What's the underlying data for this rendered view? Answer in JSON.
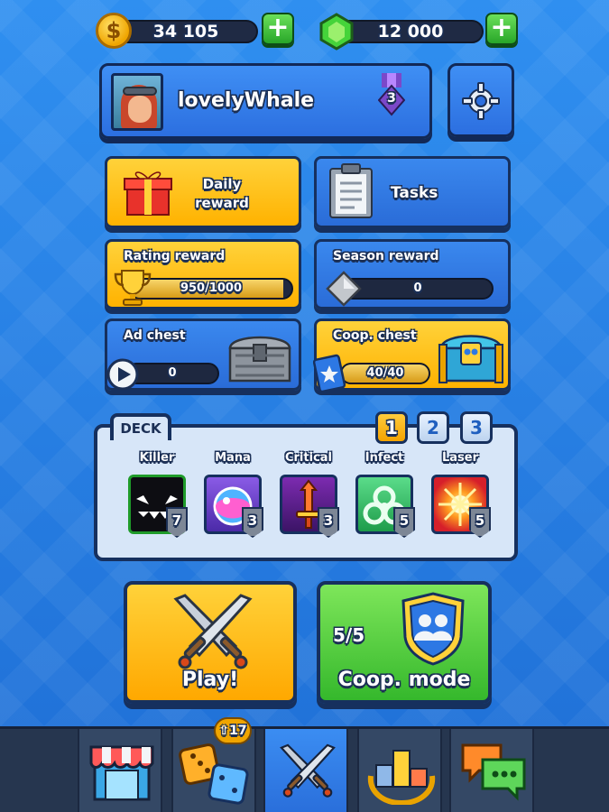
{
  "currency": {
    "coins": "34 105",
    "gems": "12 000",
    "coin_icon": "coin-icon",
    "gem_icon": "gem-icon",
    "plus_symbol": "+"
  },
  "profile": {
    "username": "lovelyWhale",
    "rank": "3",
    "settings_icon": "gear-icon"
  },
  "cards": {
    "daily_reward": "Daily\nreward",
    "tasks": "Tasks",
    "rating_reward": {
      "title": "Rating reward",
      "progress_text": "950/1000",
      "progress": 0.95
    },
    "season_reward": {
      "title": "Season reward",
      "progress_text": "0",
      "progress": 0
    },
    "ad_chest": {
      "title": "Ad chest",
      "progress_text": "0",
      "progress": 0
    },
    "coop_chest": {
      "title": "Coop. chest",
      "progress_text": "40/40",
      "progress": 1.0
    }
  },
  "deck": {
    "title": "DECK",
    "pages": [
      "1",
      "2",
      "3"
    ],
    "active_page": "1",
    "cards": [
      {
        "name": "Killer",
        "level": "7"
      },
      {
        "name": "Mana",
        "level": "3"
      },
      {
        "name": "Critical",
        "level": "3"
      },
      {
        "name": "Infect",
        "level": "5"
      },
      {
        "name": "Laser",
        "level": "5"
      }
    ]
  },
  "actions": {
    "play_label": "Play!",
    "coop_label": "Coop. mode",
    "coop_count": "5/5"
  },
  "nav": {
    "upgrade_badge": "17",
    "items": [
      "shop-icon",
      "dice-icon",
      "battle-icon",
      "leaderboard-icon",
      "chat-icon"
    ],
    "active": "battle-icon"
  },
  "colors": {
    "accent_yellow": "#ffb200",
    "accent_green": "#35b82c",
    "background_blue": "#2a7ee6",
    "outline": "#16305e"
  }
}
